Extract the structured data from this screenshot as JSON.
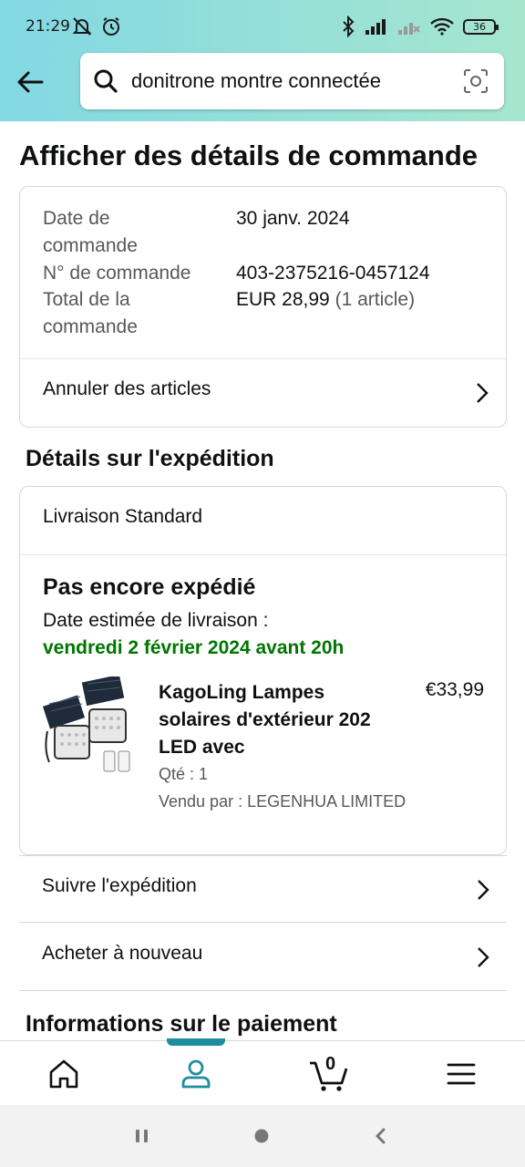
{
  "status_bar": {
    "time": "21:29",
    "battery": "36"
  },
  "search": {
    "query": "donitrone montre connectée"
  },
  "page": {
    "title": "Afficher des détails de commande"
  },
  "order_summary": {
    "date_label": "Date de commande",
    "date_value": "30 janv. 2024",
    "number_label": "N° de commande",
    "number_value": "403-2375216-0457124",
    "total_label": "Total de la commande",
    "total_value": "EUR 28,99",
    "total_count": "(1 article)",
    "cancel_label": "Annuler des articles"
  },
  "shipping": {
    "section_title": "Détails sur l'expédition",
    "method": "Livraison Standard",
    "status": "Pas encore expédié",
    "estimated_label": "Date estimée de livraison :",
    "estimated_date": "vendredi 2 février 2024 avant 20h",
    "item": {
      "title": "KagoLing Lampes solaires d'extérieur 202 LED avec",
      "price": "€33,99",
      "qty": "Qté : 1",
      "seller": "Vendu par : LEGENHUA LIMITED"
    }
  },
  "actions": {
    "track": "Suivre l'expédition",
    "buy_again": "Acheter à nouveau"
  },
  "payment": {
    "section_title": "Informations sur le paiement"
  },
  "bottom_nav": {
    "cart_count": "0",
    "active": "account"
  },
  "colors": {
    "accent": "#1d8ea0",
    "delivery_green": "#007600",
    "header_start": "#82d8e3",
    "header_end": "#a6e6ce"
  }
}
